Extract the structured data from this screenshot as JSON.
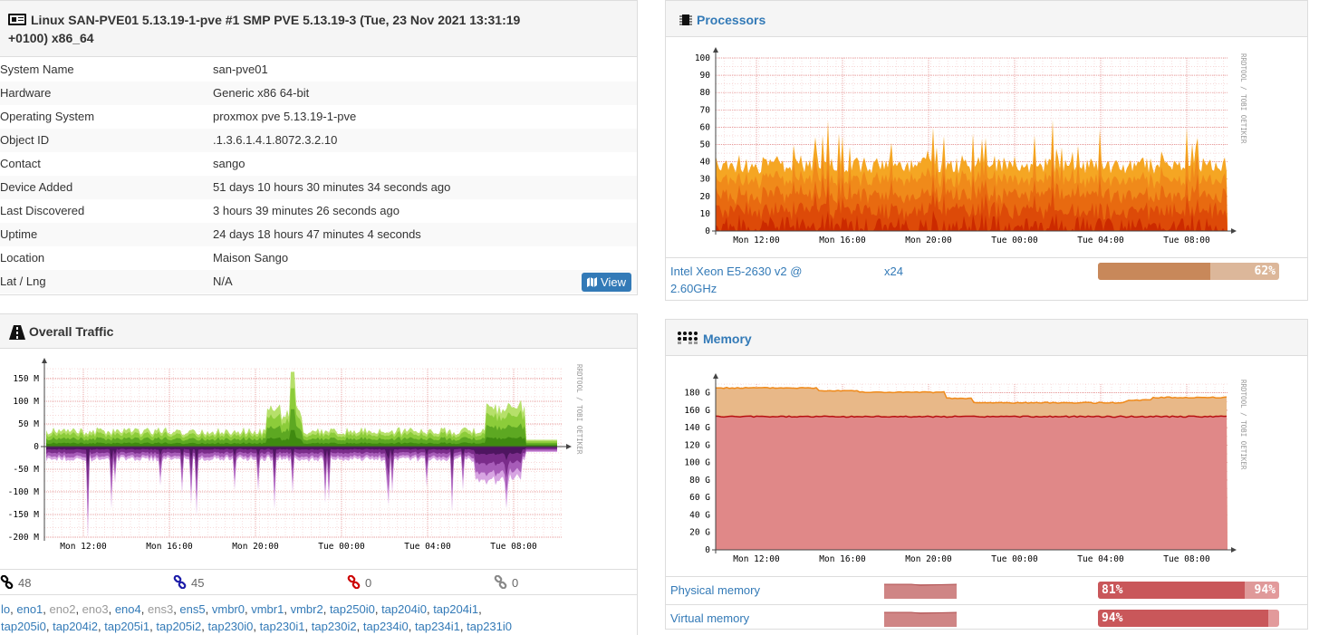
{
  "overview": {
    "title": "Linux SAN-PVE01 5.13.19-1-pve #1 SMP PVE 5.13.19-3 (Tue, 23 Nov 2021 13:31:19 +0100) x86_64",
    "title_line1": "Linux SAN-PVE01 5.13.19-1-pve #1 SMP PVE 5.13.19-3 (Tue, 23 Nov 2021 13:31:19",
    "title_line2": "+0100) x86_64",
    "rows": [
      {
        "label": "System Name",
        "value": "san-pve01"
      },
      {
        "label": "Hardware",
        "value": "Generic x86 64-bit"
      },
      {
        "label": "Operating System",
        "value": "proxmox pve 5.13.19-1-pve"
      },
      {
        "label": "Object ID",
        "value": ".1.3.6.1.4.1.8072.3.2.10"
      },
      {
        "label": "Contact",
        "value": "sango"
      },
      {
        "label": "Device Added",
        "value": "51 days 10 hours 30 minutes 34 seconds ago"
      },
      {
        "label": "Last Discovered",
        "value": "3 hours 39 minutes 26 seconds ago"
      },
      {
        "label": "Uptime",
        "value": "24 days 18 hours 47 minutes 4 seconds"
      },
      {
        "label": "Location",
        "value": "Maison Sango"
      },
      {
        "label": "Lat / Lng",
        "value": "N/A"
      }
    ],
    "view_button": "View"
  },
  "traffic": {
    "title": "Overall Traffic",
    "graph_y_ticks": [
      "150 M",
      "100 M",
      "50 M",
      "0",
      "-50 M",
      "-100 M",
      "-150 M",
      "-200 M"
    ],
    "graph_x_ticks": [
      "Mon 12:00",
      "Mon 16:00",
      "Mon 20:00",
      "Tue 00:00",
      "Tue 04:00",
      "Tue 08:00"
    ],
    "watermark": "RRDTOOL / TOBI OETIKER",
    "port_counts": [
      {
        "count": "48",
        "color": "#000000"
      },
      {
        "count": "45",
        "color": "#1a1aa8"
      },
      {
        "count": "0",
        "color": "#cc0000"
      },
      {
        "count": "0",
        "color": "#888888"
      }
    ],
    "ports_line1": [
      {
        "name": "lo",
        "sep": ", ",
        "disabled": false
      },
      {
        "name": "eno1",
        "sep": ", ",
        "disabled": false
      },
      {
        "name": "eno2",
        "sep": ", ",
        "disabled": true
      },
      {
        "name": "eno3",
        "sep": ", ",
        "disabled": true
      },
      {
        "name": "eno4",
        "sep": ", ",
        "disabled": false
      },
      {
        "name": "ens3",
        "sep": ", ",
        "disabled": true
      },
      {
        "name": "ens5",
        "sep": ", ",
        "disabled": false
      },
      {
        "name": "vmbr0",
        "sep": ", ",
        "disabled": false
      },
      {
        "name": "vmbr1",
        "sep": ", ",
        "disabled": false
      },
      {
        "name": "vmbr2",
        "sep": ", ",
        "disabled": false
      },
      {
        "name": "tap250i0",
        "sep": ", ",
        "disabled": false
      },
      {
        "name": "tap204i0",
        "sep": ", ",
        "disabled": false
      },
      {
        "name": "tap204i1",
        "sep": ",",
        "disabled": false
      }
    ],
    "ports_line2": [
      {
        "name": "tap205i0",
        "sep": ", ",
        "disabled": false
      },
      {
        "name": "tap204i2",
        "sep": ", ",
        "disabled": false
      },
      {
        "name": "tap205i1",
        "sep": ", ",
        "disabled": false
      },
      {
        "name": "tap205i2",
        "sep": ", ",
        "disabled": false
      },
      {
        "name": "tap230i0",
        "sep": ", ",
        "disabled": false
      },
      {
        "name": "tap230i1",
        "sep": ", ",
        "disabled": false
      },
      {
        "name": "tap230i2",
        "sep": ", ",
        "disabled": false
      },
      {
        "name": "tap234i0",
        "sep": ", ",
        "disabled": false
      },
      {
        "name": "tap234i1",
        "sep": ", ",
        "disabled": false
      },
      {
        "name": "tap231i0",
        "sep": "",
        "disabled": false
      }
    ]
  },
  "processors": {
    "title": "Processors",
    "graph_y_ticks": [
      "100",
      "90",
      "80",
      "70",
      "60",
      "50",
      "40",
      "30",
      "20",
      "10",
      "0"
    ],
    "graph_x_ticks": [
      "Mon 12:00",
      "Mon 16:00",
      "Mon 20:00",
      "Tue 00:00",
      "Tue 04:00",
      "Tue 08:00"
    ],
    "watermark": "RRDTOOL / TOBI OETIKER",
    "cpu_line1": "Intel Xeon E5-2630 v2 @",
    "cpu_line2": "2.60GHz",
    "count": "x24",
    "usage_label": "62%",
    "usage_percent": 62
  },
  "memory": {
    "title": "Memory",
    "graph_y_ticks": [
      "180 G",
      "160 G",
      "140 G",
      "120 G",
      "100 G",
      "80 G",
      "60 G",
      "40 G",
      "20 G",
      "0"
    ],
    "graph_x_ticks": [
      "Mon 12:00",
      "Mon 16:00",
      "Mon 20:00",
      "Tue 00:00",
      "Tue 04:00",
      "Tue 08:00"
    ],
    "watermark": "RRDTOOL / TOBI OETIKER",
    "rows": [
      {
        "label": "Physical memory",
        "used_label": "81%",
        "used_percent": 81,
        "extra_label": "94%",
        "extra_percent": 94
      },
      {
        "label": "Virtual memory",
        "used_label": "94%",
        "used_percent": 94
      }
    ]
  },
  "colors": {
    "link": "#337ab7",
    "cpu_bar": "#c8885a",
    "cpu_bar_bg": "#dcb79a",
    "mem_bar": "#c9575a",
    "mem_bar_bg": "#e29a9b",
    "traffic_in": "#7bc22f",
    "traffic_out": "#8e3b9a",
    "cpu_fill": "#f07c14",
    "mem_used": "#e08888",
    "mem_total": "#e8b888"
  }
}
